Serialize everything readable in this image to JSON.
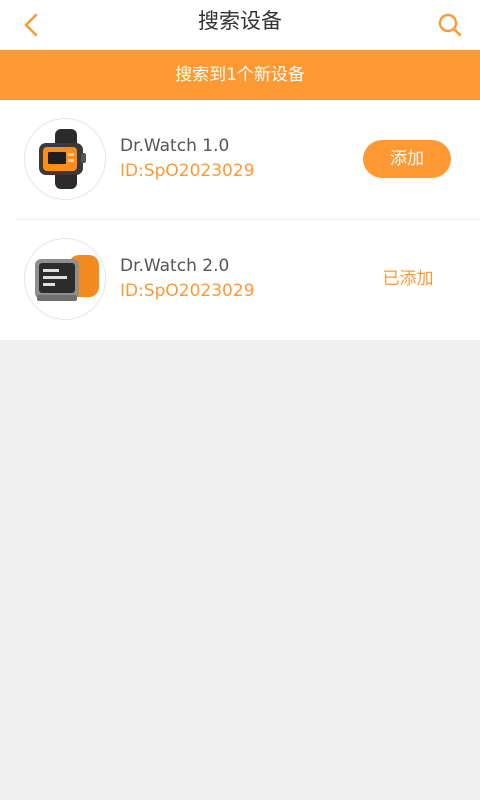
{
  "header": {
    "title": "搜索设备",
    "back_icon": "chevron-left-icon",
    "search_icon": "search-icon",
    "accent_color": "#ff9933"
  },
  "banner": {
    "text": "搜索到1个新设备"
  },
  "devices": [
    {
      "name": "Dr.Watch 1.0",
      "id": "ID:SpO2023029",
      "action_label": "添加",
      "image_icon": "black-watch-image"
    },
    {
      "name": "Dr.Watch 2.0",
      "id": "ID:SpO2023029",
      "action_label": "已添加",
      "image_icon": "orange-watch-image"
    }
  ]
}
